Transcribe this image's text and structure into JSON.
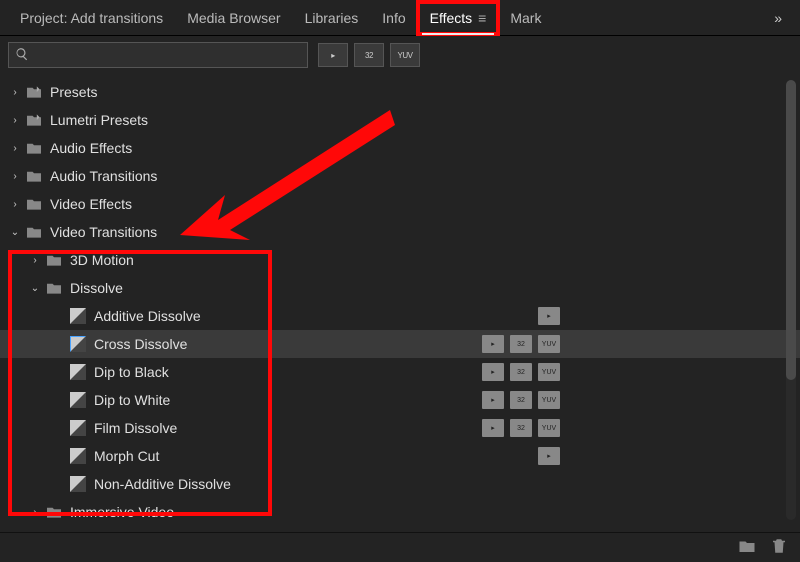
{
  "tabs": {
    "project": "Project: Add transitions",
    "media": "Media Browser",
    "libraries": "Libraries",
    "info": "Info",
    "effects": "Effects",
    "markers": "Mark",
    "overflow": "»"
  },
  "search": {
    "placeholder": ""
  },
  "badge_buttons": [
    "▸",
    "32",
    "YUV"
  ],
  "tree": {
    "presets": "Presets",
    "lumetri_presets": "Lumetri Presets",
    "audio_effects": "Audio Effects",
    "audio_transitions": "Audio Transitions",
    "video_effects": "Video Effects",
    "video_transitions": "Video Transitions",
    "motion3d": "3D Motion",
    "dissolve": "Dissolve",
    "dissolve_children": {
      "additive": "Additive Dissolve",
      "cross": "Cross Dissolve",
      "dip_black": "Dip to Black",
      "dip_white": "Dip to White",
      "film": "Film Dissolve",
      "morph": "Morph Cut",
      "non_additive": "Non-Additive Dissolve"
    },
    "immersive": "Immersive Video"
  },
  "mini_badges": {
    "accel": "▸",
    "b32": "32",
    "yuv": "YUV"
  },
  "annotations": {
    "highlight_tab": "Effects",
    "tree_box": true,
    "arrow": true
  }
}
